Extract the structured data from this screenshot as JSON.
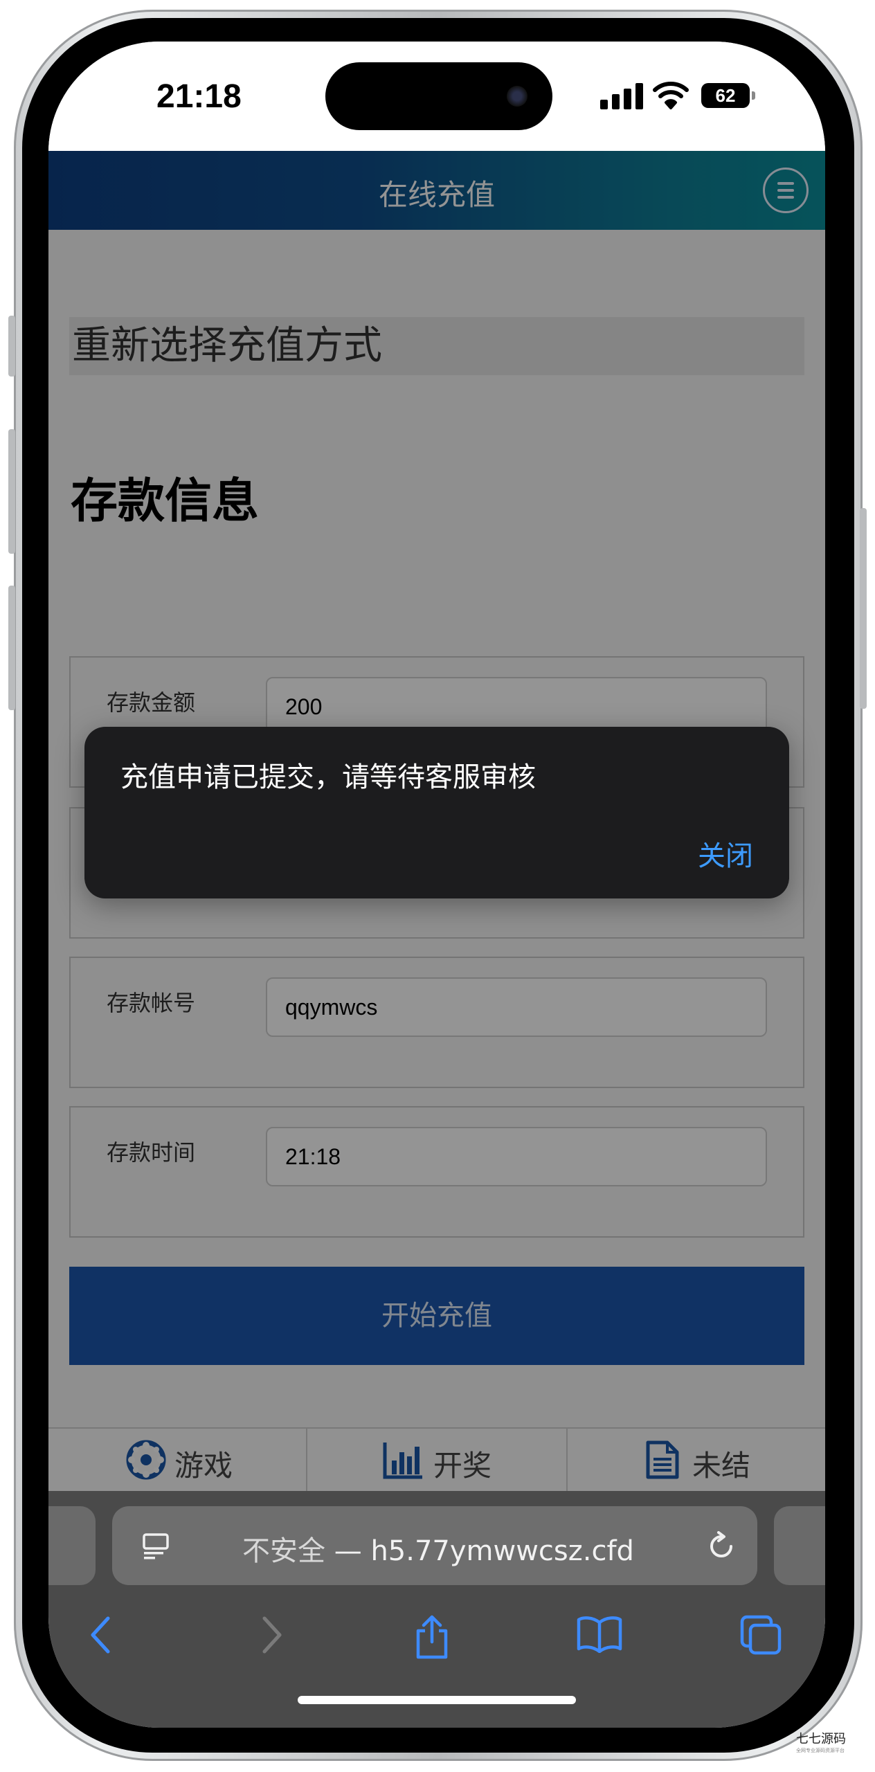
{
  "status_bar": {
    "time": "21:18",
    "battery": "62"
  },
  "header": {
    "title": "在线充值"
  },
  "page": {
    "reselect": "重新选择充值方式",
    "section_title": "存款信息",
    "fields": [
      {
        "label": "存款金额",
        "value": "200"
      },
      {
        "label": "",
        "value": ""
      },
      {
        "label": "存款帐号",
        "value": "qqymwcs"
      },
      {
        "label": "存款时间",
        "value": "21:18"
      }
    ],
    "submit": "开始充值"
  },
  "tabs": [
    {
      "label": "游戏",
      "icon": "game-wheel-icon"
    },
    {
      "label": "开奖",
      "icon": "bar-chart-icon"
    },
    {
      "label": "未结",
      "icon": "document-icon"
    }
  ],
  "dialog": {
    "message": "充值申请已提交，请等待客服审核",
    "close": "关闭"
  },
  "browser": {
    "insecure": "不安全",
    "separator": " — ",
    "domain": "h5.77ymwwcsz.cfd"
  },
  "watermark": {
    "brand": "七七源码",
    "tagline": "全网专业源码资源平台"
  },
  "colors": {
    "accent_blue": "#1c57ad",
    "link_blue": "#3d9bff",
    "toast_bg": "#1c1c1e"
  }
}
